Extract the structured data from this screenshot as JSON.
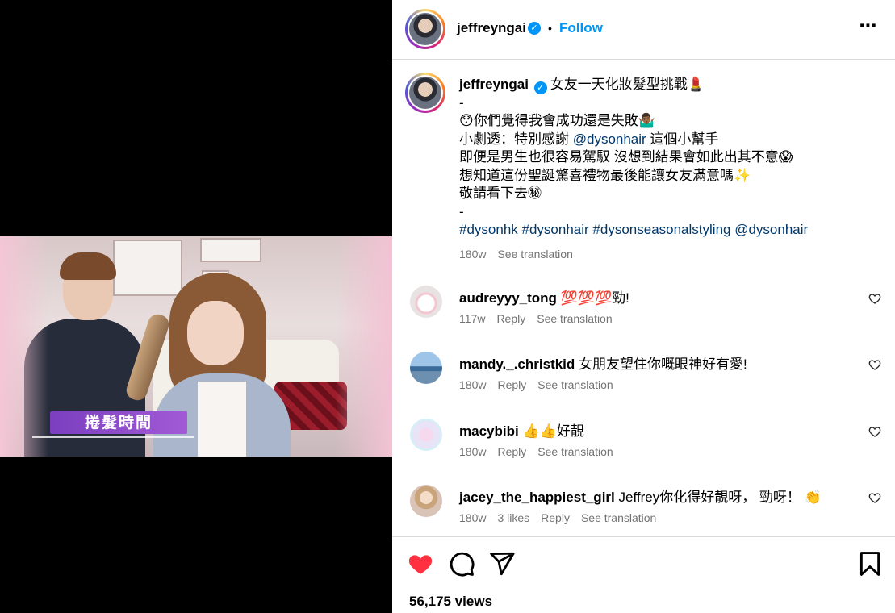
{
  "header": {
    "username": "jeffreyngai",
    "separator": "•",
    "follow_label": "Follow",
    "more_label": "⋯"
  },
  "caption": {
    "username": "jeffreyngai",
    "line1": "女友一天化妝髮型挑戰💄",
    "line2": "-",
    "line3": "😯你們覺得我會成功還是失敗🤷🏾‍♂️",
    "line4_prefix": "小劇透：特別感謝 ",
    "line4_mention": "@dysonhair",
    "line4_suffix": " 這個小幫手",
    "line5": "即便是男生也很容易駕馭 沒想到結果會如此出其不意😱",
    "line6": "想知道這份聖誕驚喜禮物最後能讓女友滿意嗎✨",
    "line7": "敬請看下去㊙",
    "line8": "-",
    "hashtags": [
      "#dysonhk",
      "#dysonhair",
      "#dysonseasonalstyling",
      "@dysonhair"
    ],
    "age": "180w",
    "see_translation": "See translation"
  },
  "video": {
    "banner_text": "捲髮時間"
  },
  "comments": [
    {
      "user": "audreyyy_tong",
      "text": "💯💯💯勁!",
      "age": "117w",
      "likes": "",
      "reply": "Reply",
      "translate": "See translation"
    },
    {
      "user": "mandy._.christkid",
      "text": "女朋友望住你嘅眼神好有愛!",
      "age": "180w",
      "likes": "",
      "reply": "Reply",
      "translate": "See translation"
    },
    {
      "user": "macybibi",
      "text": "👍👍好靚",
      "age": "180w",
      "likes": "",
      "reply": "Reply",
      "translate": "See translation"
    },
    {
      "user": "jacey_the_happiest_girl",
      "text": "Jeffrey你化得好靚呀， 勁呀！ 👏",
      "age": "180w",
      "likes": "3 likes",
      "reply": "Reply",
      "translate": "See translation"
    }
  ],
  "stats": {
    "views": "56,175 views"
  },
  "colors": {
    "accent": "#0095f6",
    "like_red": "#ff3040",
    "link": "#00376b",
    "muted": "#737373"
  },
  "icons": [
    "verified-badge-icon",
    "more-options-icon",
    "heart-icon",
    "comment-icon",
    "share-icon",
    "bookmark-icon",
    "like-comment-icon"
  ]
}
